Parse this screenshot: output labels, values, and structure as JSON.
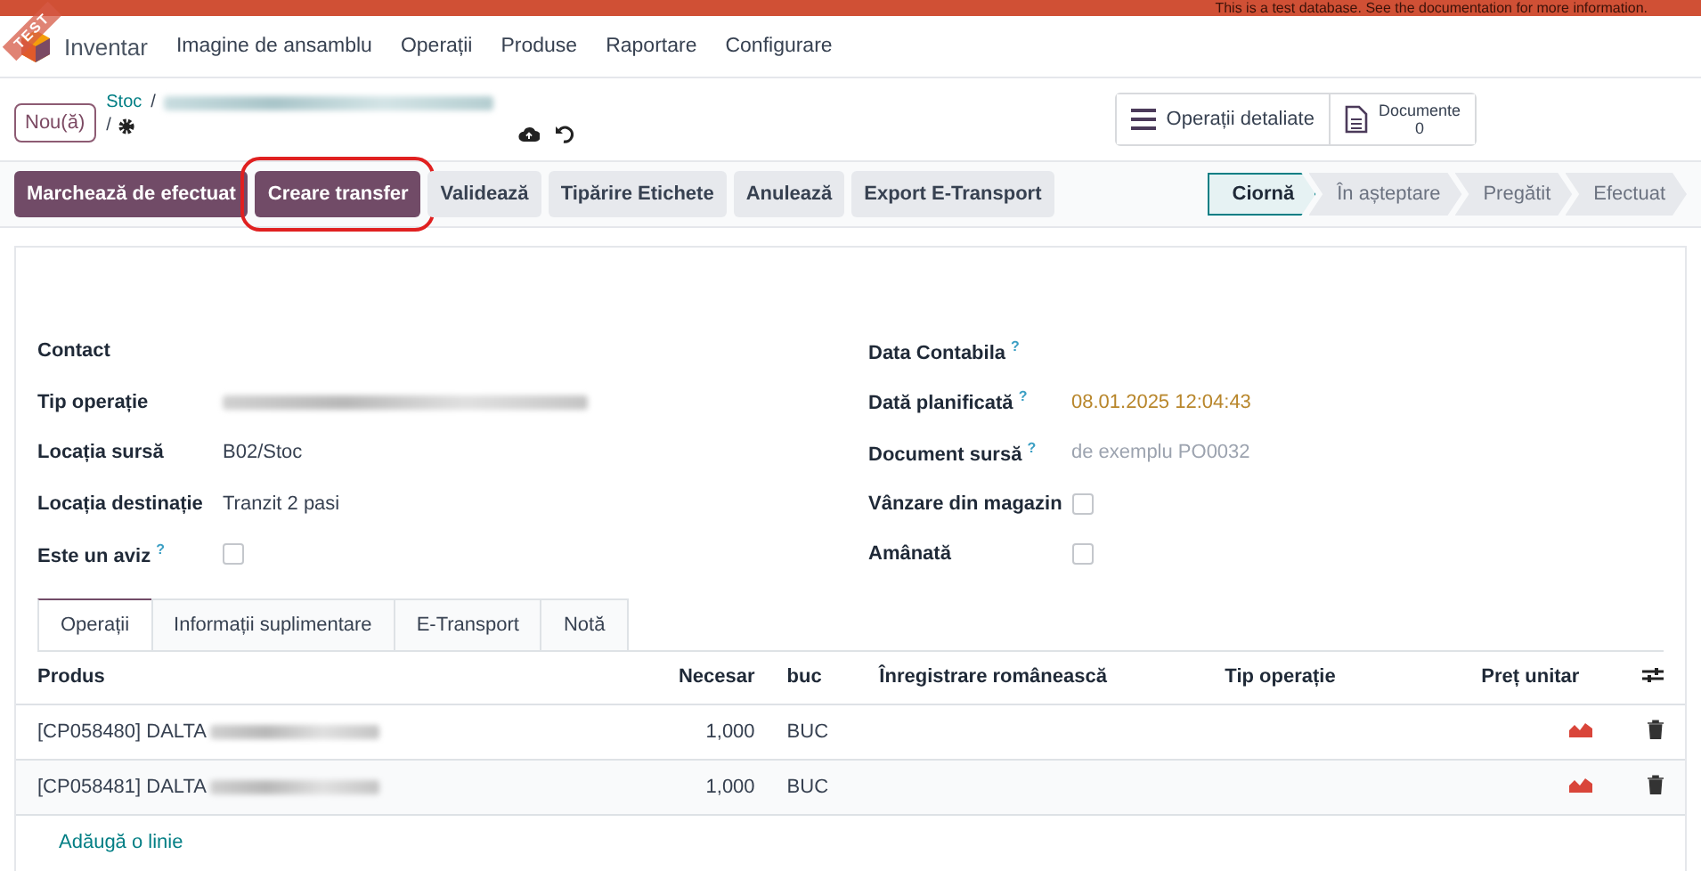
{
  "banner": {
    "text": "This is a test database. See the documentation for more information."
  },
  "ribbon": {
    "text": "TEST"
  },
  "navbar": {
    "app_name": "Inventar",
    "menu": [
      "Imagine de ansamblu",
      "Operații",
      "Produse",
      "Raportare",
      "Configurare"
    ]
  },
  "control_panel": {
    "new_button": "Nou(ă)",
    "breadcrumb_root": "Stoc",
    "separator": "/",
    "record_separator": "/",
    "smart_buttons": [
      {
        "kind": "list",
        "label": "Operații detaliate"
      },
      {
        "kind": "document",
        "label": "Documente",
        "count": "0"
      }
    ]
  },
  "actions": [
    {
      "label": "Marchează de efectuat",
      "primary": true,
      "highlighted": false
    },
    {
      "label": "Creare transfer",
      "primary": true,
      "highlighted": true
    },
    {
      "label": "Validează",
      "primary": false,
      "highlighted": false
    },
    {
      "label": "Tipărire Etichete",
      "primary": false,
      "highlighted": false
    },
    {
      "label": "Anulează",
      "primary": false,
      "highlighted": false
    },
    {
      "label": "Export E-Transport",
      "primary": false,
      "highlighted": false
    }
  ],
  "status_steps": [
    {
      "label": "Ciornă",
      "selected": true
    },
    {
      "label": "În așteptare",
      "selected": false
    },
    {
      "label": "Pregătit",
      "selected": false
    },
    {
      "label": "Efectuat",
      "selected": false
    }
  ],
  "fields_left": [
    {
      "label": "Contact",
      "help": false,
      "kind": "empty"
    },
    {
      "label": "Tip operație",
      "help": false,
      "kind": "redacted"
    },
    {
      "label": "Locația sursă",
      "help": false,
      "kind": "text",
      "value": "B02/Stoc"
    },
    {
      "label": "Locația destinație",
      "help": false,
      "kind": "text",
      "value": "Tranzit 2 pasi"
    },
    {
      "label": "Este un aviz",
      "help": true,
      "kind": "checkbox",
      "checked": false
    }
  ],
  "fields_right": [
    {
      "label": "Data Contabila",
      "help": true,
      "kind": "empty"
    },
    {
      "label": "Dată planificată",
      "help": true,
      "kind": "date",
      "value": "08.01.2025 12:04:43"
    },
    {
      "label": "Document sursă",
      "help": true,
      "kind": "placeholder",
      "placeholder": "de exemplu PO0032"
    },
    {
      "label": "Vânzare din magazin",
      "help": false,
      "kind": "checkbox",
      "checked": false
    },
    {
      "label": "Amânată",
      "help": false,
      "kind": "checkbox",
      "checked": false
    }
  ],
  "help_mark": "?",
  "tabs": [
    {
      "label": "Operații",
      "selected": true
    },
    {
      "label": "Informații suplimentare",
      "selected": false
    },
    {
      "label": "E-Transport",
      "selected": false
    },
    {
      "label": "Notă",
      "selected": false
    }
  ],
  "table": {
    "columns": [
      "Produs",
      "Necesar",
      "buc",
      "Înregistrare românească",
      "Tip operație",
      "Preț unitar"
    ],
    "rows": [
      {
        "product": "[CP058480] DALTA",
        "quantity": "1,000",
        "uom": "BUC"
      },
      {
        "product": "[CP058481] DALTA",
        "quantity": "1,000",
        "uom": "BUC"
      }
    ],
    "add_line": "Adăugă o linie"
  }
}
